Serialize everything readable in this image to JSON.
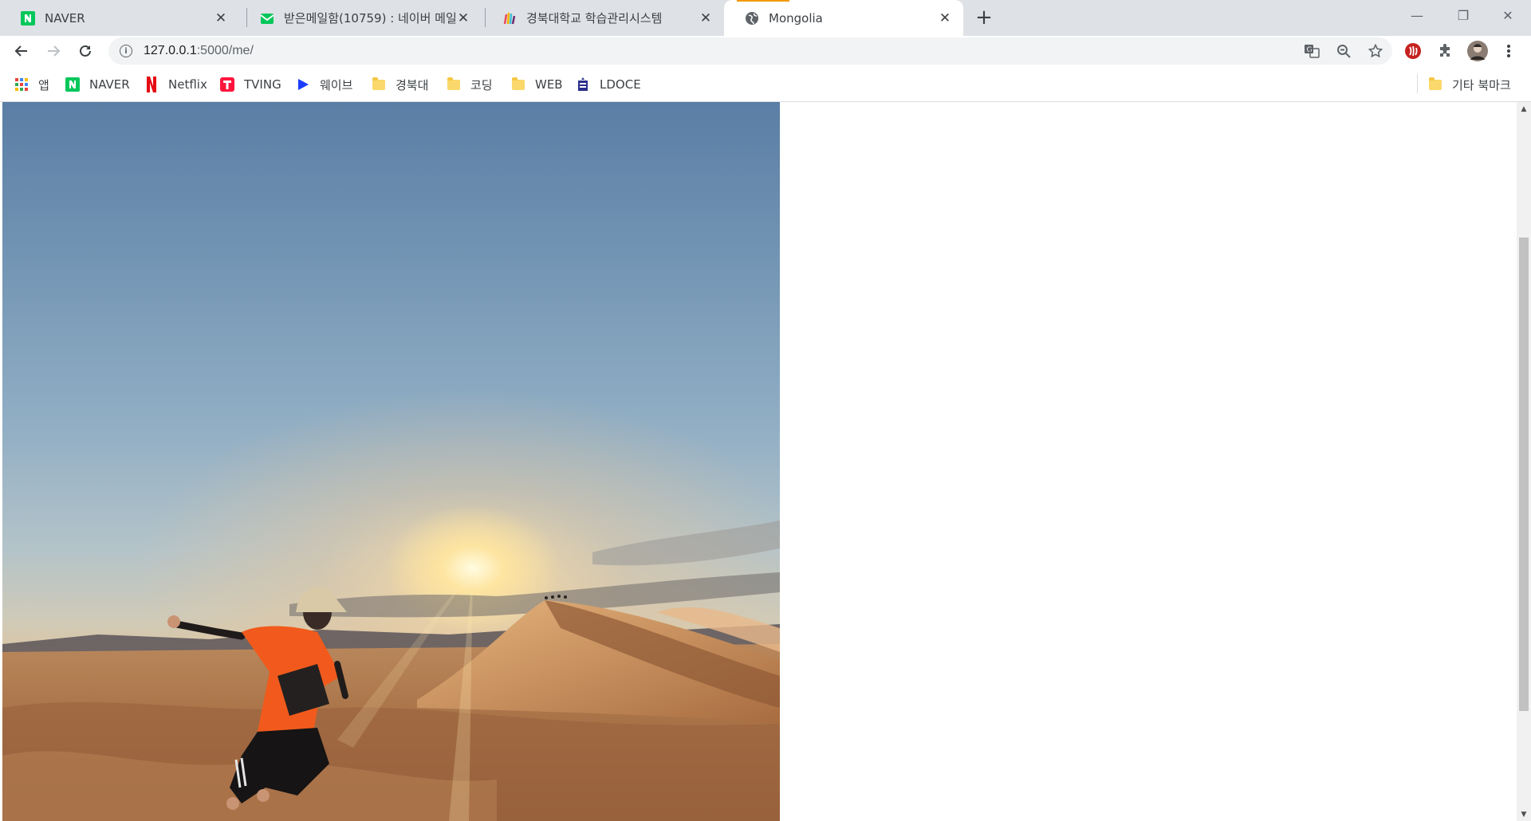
{
  "tabs": [
    {
      "title": "NAVER",
      "icon": "naver-icon",
      "active": false
    },
    {
      "title": "받은메일함(10759) : 네이버 메일",
      "icon": "mail-icon",
      "active": false
    },
    {
      "title": "경북대학교 학습관리시스템",
      "icon": "lms-icon",
      "active": false
    },
    {
      "title": "Mongolia",
      "icon": "globe-icon",
      "active": true
    }
  ],
  "toolbar": {
    "url_host": "127.0.0.1",
    "url_path": ":5000/me/"
  },
  "bookmarks": [
    {
      "label": "앱",
      "icon": "apps-grid-icon"
    },
    {
      "label": "NAVER",
      "icon": "naver-icon"
    },
    {
      "label": "Netflix",
      "icon": "netflix-icon"
    },
    {
      "label": "TVING",
      "icon": "tving-icon"
    },
    {
      "label": "웨이브",
      "icon": "wavve-icon"
    },
    {
      "label": "경북대",
      "icon": "folder-icon"
    },
    {
      "label": "코딩",
      "icon": "folder-icon"
    },
    {
      "label": "WEB",
      "icon": "folder-icon"
    },
    {
      "label": "LDOCE",
      "icon": "ldoce-icon"
    }
  ],
  "other_bookmarks": {
    "label": "기타 북마크",
    "icon": "folder-icon"
  },
  "colors": {
    "tabstrip": "#dee1e6",
    "naver_green": "#03c75a",
    "netflix_red": "#e50914",
    "tving_red": "#ff153c",
    "wavve_blue": "#1a3cff",
    "active_tab_accent": "#f29900"
  }
}
